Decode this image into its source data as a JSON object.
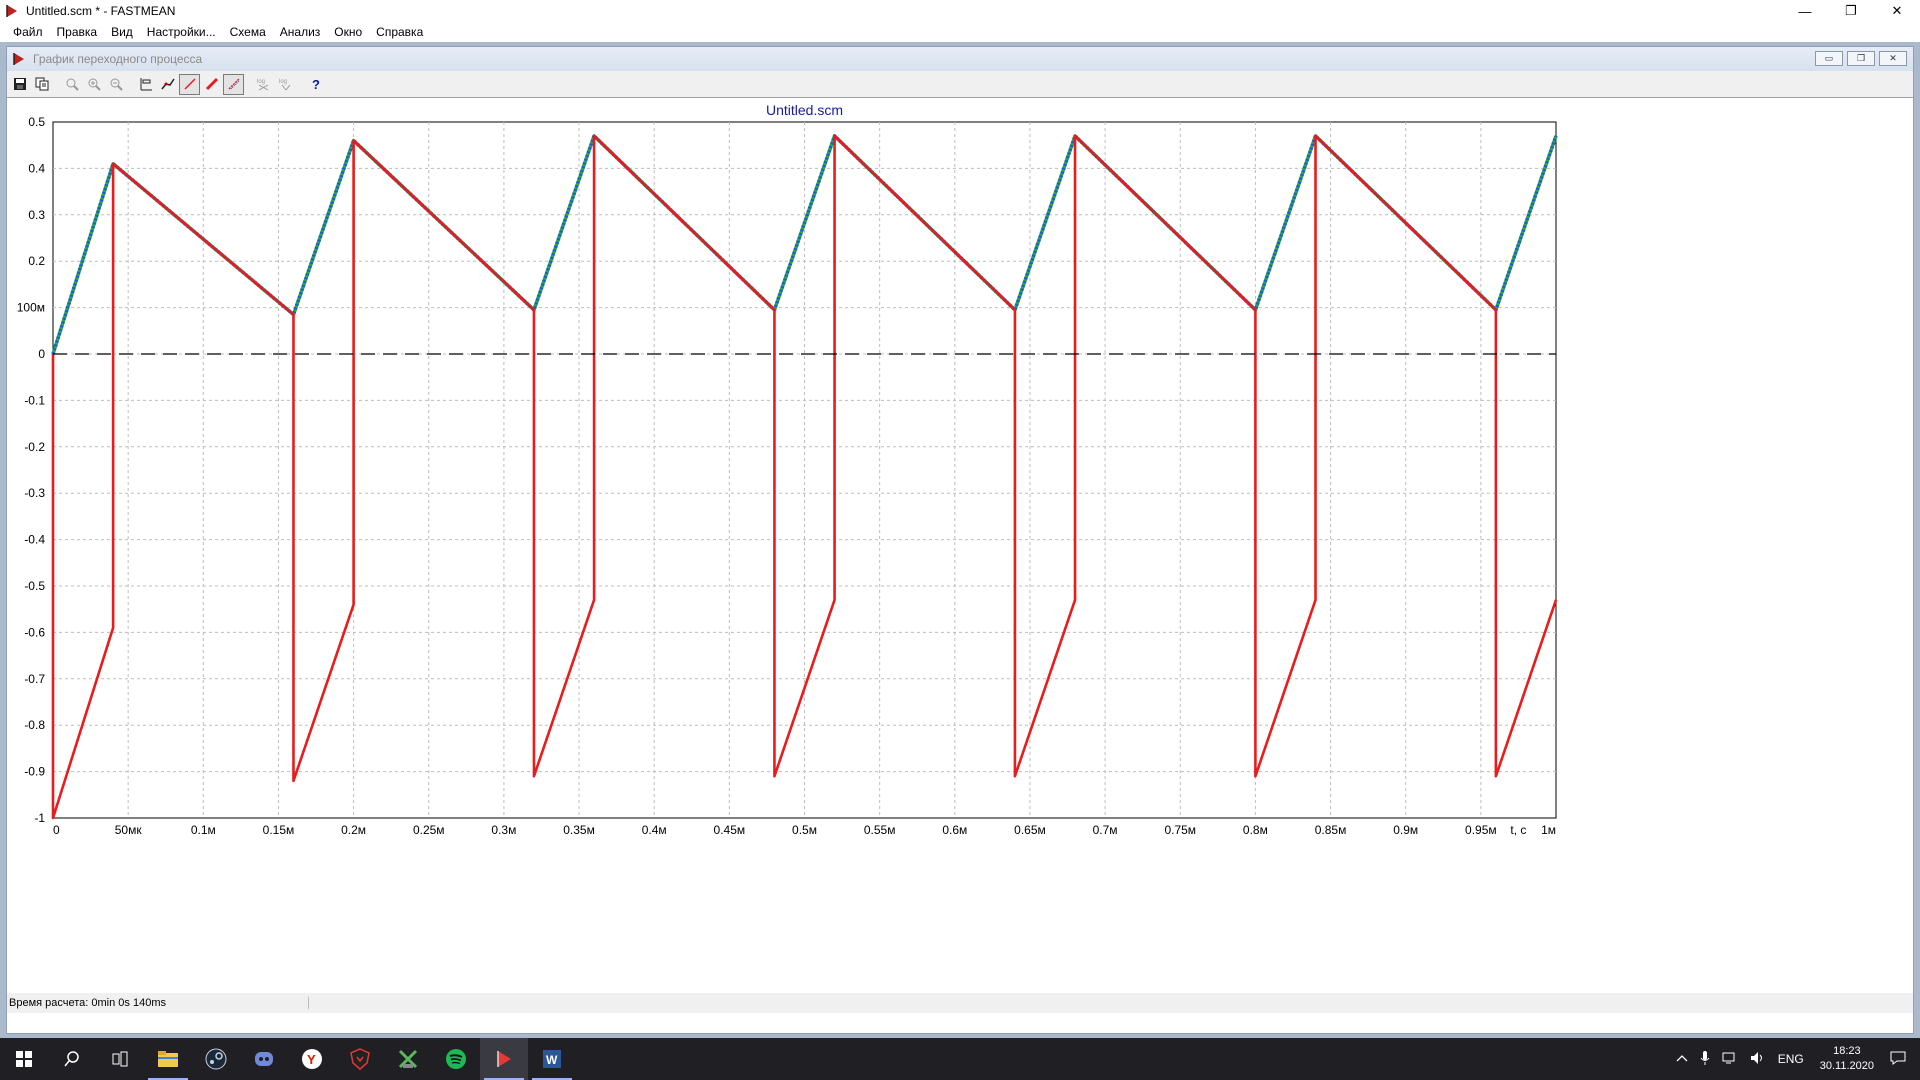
{
  "window": {
    "title": "Untitled.scm * - FASTMEAN",
    "controls": [
      "—",
      "❐",
      "✕"
    ]
  },
  "menu": [
    "Файл",
    "Правка",
    "Вид",
    "Настройки...",
    "Схема",
    "Анализ",
    "Окно",
    "Справка"
  ],
  "child_window": {
    "title": "График переходного процесса"
  },
  "status": {
    "text": "Время расчета: 0min 0s 140ms"
  },
  "taskbar": {
    "apps": [
      "start-icon",
      "search-icon",
      "task-view-icon",
      "file-explorer-icon",
      "steam-icon",
      "discord-icon",
      "yandex-browser-icon",
      "shield-app-icon",
      "xbox-like-icon",
      "spotify-icon",
      "fastmean-icon",
      "word-icon"
    ],
    "tray": {
      "lang": "ENG",
      "time": "18:23",
      "date": "30.11.2020"
    }
  },
  "chart_data": {
    "type": "line",
    "title": "Untitled.scm",
    "xlabel": "t, c",
    "ylabel": "",
    "xlim": [
      0,
      0.001
    ],
    "ylim": [
      -1,
      0.5
    ],
    "x_ticks": [
      0,
      5e-05,
      0.0001,
      0.00015,
      0.0002,
      0.00025,
      0.0003,
      0.00035,
      0.0004,
      0.00045,
      0.0005,
      0.00055,
      0.0006,
      0.00065,
      0.0007,
      0.00075,
      0.0008,
      0.00085,
      0.0009,
      0.00095,
      0.001
    ],
    "x_tick_labels": [
      "0",
      "50мк",
      "0.1м",
      "0.15м",
      "0.2м",
      "0.25м",
      "0.3м",
      "0.35м",
      "0.4м",
      "0.45м",
      "0.5м",
      "0.55м",
      "0.6м",
      "0.65м",
      "0.7м",
      "0.75м",
      "0.8м",
      "0.85м",
      "0.9м",
      "0.95м",
      "1м"
    ],
    "y_ticks": [
      0.5,
      0.4,
      0.3,
      0.2,
      0.1,
      0,
      -0.1,
      -0.2,
      -0.3,
      -0.4,
      -0.5,
      -0.6,
      -0.7,
      -0.8,
      -0.9,
      -1
    ],
    "y_tick_labels": [
      "0.5",
      "0.4",
      "0.3",
      "0.2",
      "100м",
      "0",
      "-0.1",
      "-0.2",
      "-0.3",
      "-0.4",
      "-0.5",
      "-0.6",
      "-0.7",
      "-0.8",
      "-0.9",
      "-1"
    ],
    "grid": true,
    "series": [
      {
        "color": "#1a5fd0",
        "style": "dotted-double",
        "x": [
          0,
          4e-05,
          0.00016,
          0.0002,
          0.00032,
          0.00036,
          0.00048,
          0.00052,
          0.00064,
          0.00068,
          0.0008,
          0.00084,
          0.00096,
          0.001
        ],
        "y": [
          0,
          0.41,
          0.085,
          0.46,
          0.095,
          0.47,
          0.095,
          0.47,
          0.095,
          0.47,
          0.095,
          0.47,
          0.095,
          0.47
        ]
      },
      {
        "color": "#e81c1c",
        "style": "solid",
        "x": [
          0,
          0,
          4e-05,
          4e-05,
          0.00016,
          0.00016,
          0.0002,
          0.0002,
          0.00032,
          0.00032,
          0.00036,
          0.00036,
          0.00048,
          0.00048,
          0.00052,
          0.00052,
          0.00064,
          0.00064,
          0.00068,
          0.00068,
          0.0008,
          0.0008,
          0.00084,
          0.00084,
          0.00096,
          0.00096,
          0.001
        ],
        "y": [
          0,
          -1,
          -0.59,
          0.41,
          0.085,
          -0.92,
          -0.54,
          0.46,
          0.095,
          -0.91,
          -0.53,
          0.47,
          0.095,
          -0.91,
          -0.53,
          0.47,
          0.095,
          -0.91,
          -0.53,
          0.47,
          0.095,
          -0.91,
          -0.53,
          0.47,
          0.095,
          -0.91,
          -0.53
        ]
      },
      {
        "color": "#000000",
        "style": "dashed",
        "x": [
          0,
          0.001
        ],
        "y": [
          0,
          0
        ]
      }
    ]
  }
}
